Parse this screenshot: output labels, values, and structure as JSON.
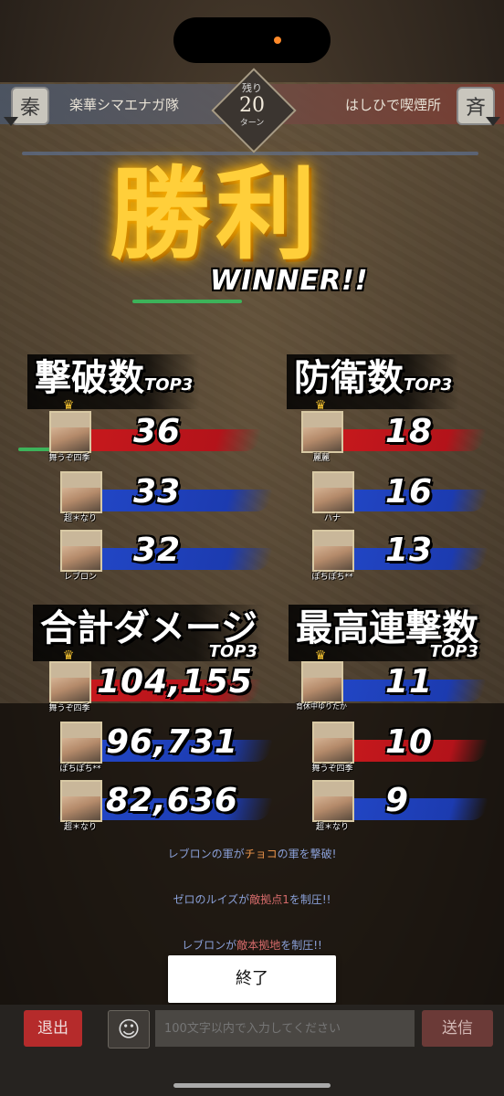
{
  "header": {
    "left_emblem": "秦",
    "left_team": "楽華シマエナガ隊",
    "turns_label": "残り",
    "turns_value": "20",
    "turns_unit": "ターン",
    "right_emblem": "斉",
    "right_team": "はしひで喫煙所"
  },
  "victory": {
    "kanji": "勝利",
    "english": "WINNER!!"
  },
  "rankings": {
    "kills": {
      "title": "撃破数",
      "tag": "TOP3",
      "entries": [
        {
          "name": "舞うぞ四季",
          "value": "36",
          "color": "red"
        },
        {
          "name": "超＊なり",
          "value": "33",
          "color": "blue"
        },
        {
          "name": "レブロン",
          "value": "32",
          "color": "blue"
        }
      ]
    },
    "defense": {
      "title": "防衛数",
      "tag": "TOP3",
      "entries": [
        {
          "name": "麗麗",
          "value": "18",
          "color": "red"
        },
        {
          "name": "ハナ",
          "value": "16",
          "color": "blue"
        },
        {
          "name": "ぽちぽち**",
          "value": "13",
          "color": "blue"
        }
      ]
    },
    "damage": {
      "title": "合計ダメージ",
      "tag": "TOP3",
      "entries": [
        {
          "name": "舞うぞ四季",
          "value": "104,155",
          "color": "red"
        },
        {
          "name": "ぽちぽち**",
          "value": "96,731",
          "color": "blue"
        },
        {
          "name": "超＊なり",
          "value": "82,636",
          "color": "blue"
        }
      ]
    },
    "combo": {
      "title": "最高連撃数",
      "tag": "TOP3",
      "entries": [
        {
          "name": "育休中ゆりたか",
          "value": "11",
          "color": "blue"
        },
        {
          "name": "舞うぞ四季",
          "value": "10",
          "color": "red"
        },
        {
          "name": "超＊なり",
          "value": "9",
          "color": "blue"
        }
      ]
    }
  },
  "log": {
    "line1": {
      "a": "レブロン",
      "b": "の軍が",
      "c": "チョコ",
      "d": "の軍を撃破!"
    },
    "line2": {
      "a": "ゼロのルイズ",
      "b": "が",
      "c": "敵拠点1",
      "d": "を制圧!!"
    },
    "line3": {
      "a": "レブロン",
      "b": "が",
      "c": "敵本拠地",
      "d": "を制圧!!"
    }
  },
  "end_button": "終了",
  "footer": {
    "exit_label": "退出",
    "emoji_icon": "smiley-icon",
    "chat_placeholder": "100文字以内で入力してください",
    "send_label": "送信"
  },
  "colors": {
    "gold": "#ffcf3a",
    "red_stroke": "#c8191d",
    "blue_stroke": "#2247c7",
    "exit_red": "#b52b2b"
  }
}
